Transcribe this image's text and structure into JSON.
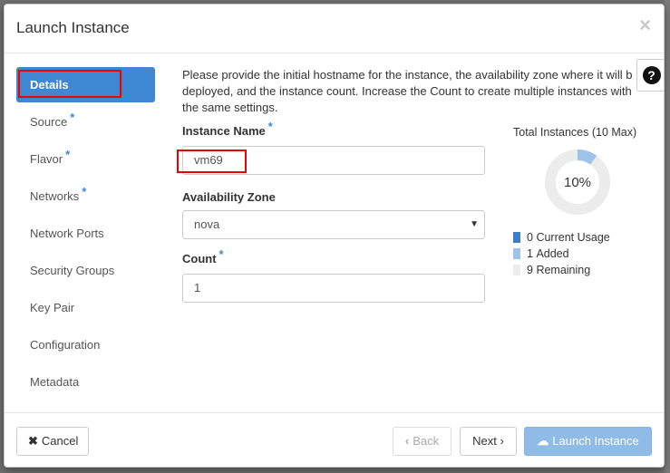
{
  "modal": {
    "title": "Launch Instance",
    "close_glyph": "×"
  },
  "nav": {
    "items": [
      {
        "label": "Details",
        "required": false,
        "active": true
      },
      {
        "label": "Source",
        "required": true
      },
      {
        "label": "Flavor",
        "required": true
      },
      {
        "label": "Networks",
        "required": true
      },
      {
        "label": "Network Ports",
        "required": false
      },
      {
        "label": "Security Groups",
        "required": false
      },
      {
        "label": "Key Pair",
        "required": false
      },
      {
        "label": "Configuration",
        "required": false
      },
      {
        "label": "Metadata",
        "required": false
      }
    ],
    "required_marker": "*"
  },
  "details": {
    "intro_lines": [
      "Please provide the initial hostname for the instance, the availability zone where it will b",
      "deployed, and the instance count. Increase the Count to create multiple instances with",
      "the same settings."
    ],
    "instance_name_label": "Instance Name",
    "instance_name_value": "vm69",
    "availability_zone_label": "Availability Zone",
    "availability_zone_value": "nova",
    "count_label": "Count",
    "count_value": "1",
    "required_marker": "*"
  },
  "usage": {
    "title": "Total Instances (10 Max)",
    "percent_label": "10%",
    "max": 10,
    "current": 0,
    "added": 1,
    "remaining": 9,
    "legend": [
      {
        "value": "0",
        "label": "Current Usage",
        "color": "#3b7fc4"
      },
      {
        "value": "1",
        "label": "Added",
        "color": "#9ec3ea"
      },
      {
        "value": "9",
        "label": "Remaining",
        "color": "#ececec"
      }
    ]
  },
  "help": {
    "icon": "question-circle-icon",
    "glyph": "?"
  },
  "footer": {
    "cancel_label": "Cancel",
    "cancel_glyph": "✖",
    "back_label": "Back",
    "back_glyph": "‹",
    "next_label": "Next",
    "next_glyph": "›",
    "launch_label": "Launch Instance",
    "launch_glyph": "☁"
  },
  "colors": {
    "accent": "#3f87d2",
    "launch_disabled": "#8fbbe6",
    "highlight": "#e00000"
  }
}
